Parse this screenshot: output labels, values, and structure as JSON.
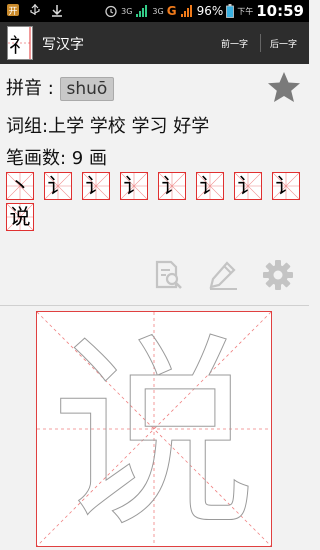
{
  "status_bar": {
    "battery": "96%",
    "time_prefix": "下午",
    "time": "10:59",
    "network_3g_a": "3G",
    "network_3g_b": "3G",
    "carrier": "G"
  },
  "action_bar": {
    "app_icon_char": "礻",
    "title": "写汉字",
    "prev_label": "前一字",
    "next_label": "后一字"
  },
  "info": {
    "pinyin_label": "拼音 :",
    "pinyin_value": "shuō",
    "words_label": "词组:",
    "words": "上学 学校 学习 好学",
    "stroke_label": "笔画数: 9 画"
  },
  "strokes": {
    "cells": [
      "丶",
      "讠",
      "讠",
      "讠",
      "讠",
      "讠",
      "讠",
      "讠",
      "说"
    ]
  },
  "tools": {
    "search_icon": "doc-search-icon",
    "edit_icon": "pencil-icon",
    "settings_icon": "gear-icon"
  },
  "colors": {
    "grid_red": "#e03030",
    "accent_orange": "#f07a1a",
    "star_gray": "#7a7a7a"
  },
  "canvas": {
    "character": "说"
  }
}
